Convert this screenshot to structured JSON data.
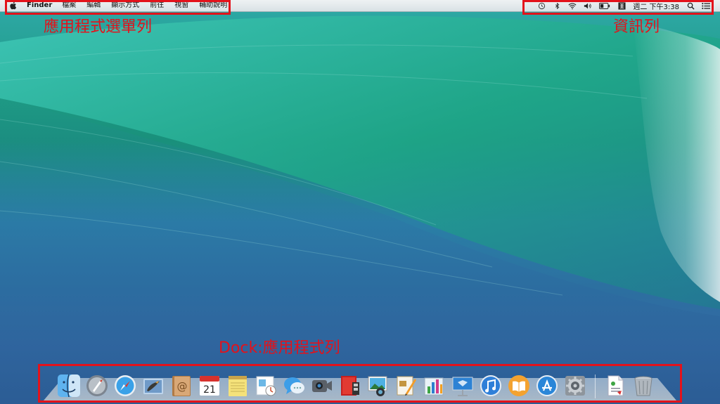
{
  "menubar": {
    "app_name": "Finder",
    "items": [
      "檔案",
      "編輯",
      "顯示方式",
      "前往",
      "視窗",
      "輔助說明"
    ],
    "clock": "週二 下午3:38"
  },
  "annotations": {
    "menu_label": "應用程式選單列",
    "status_label": "資訊列",
    "dock_label": "Dock:應用程式列",
    "color": "#e3121b"
  },
  "dock": {
    "apps": [
      "finder-icon",
      "launchpad-icon",
      "safari-icon",
      "mail-icon",
      "contacts-icon",
      "calendar-icon",
      "notes-icon",
      "reminders-icon",
      "messages-icon",
      "facetime-icon",
      "photo-booth-icon",
      "iphoto-icon",
      "pages-icon",
      "numbers-icon",
      "keynote-icon",
      "itunes-icon",
      "ibooks-icon",
      "app-store-icon",
      "system-preferences-icon"
    ],
    "calendar_day": "21",
    "right_items": [
      "document-icon",
      "trash-icon"
    ]
  }
}
